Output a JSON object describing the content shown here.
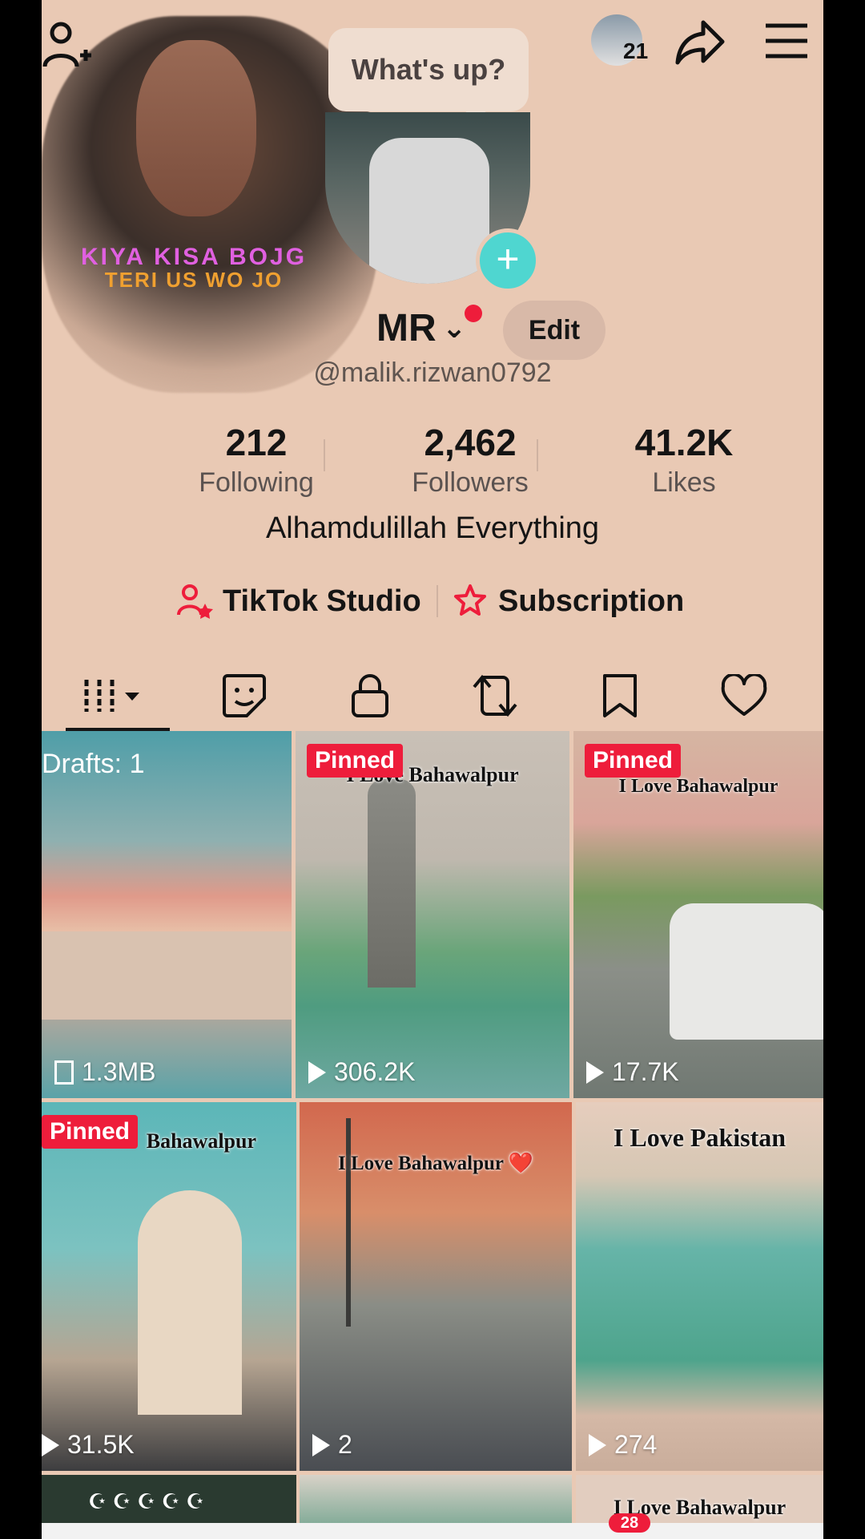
{
  "header": {
    "add_friend_icon": "person-add-icon",
    "notification_count": "21",
    "share_icon": "share-arrow-icon",
    "menu_icon": "hamburger-icon"
  },
  "tooltip": {
    "text": "What's up?"
  },
  "avatar_overlay": {
    "line1": "KIYA KISA BOJG",
    "line2": "TERI US WO JO"
  },
  "profile": {
    "name": "MR",
    "edit_label": "Edit",
    "handle": "@malik.rizwan0792",
    "bio": "Alhamdulillah Everything"
  },
  "stats": [
    {
      "value": "212",
      "label": "Following"
    },
    {
      "value": "2,462",
      "label": "Followers"
    },
    {
      "value": "41.2K",
      "label": "Likes"
    }
  ],
  "links": {
    "studio": "TikTok Studio",
    "subscription": "Subscription"
  },
  "tabs": [
    {
      "icon": "grid-icon"
    },
    {
      "icon": "sticker-icon"
    },
    {
      "icon": "lock-icon"
    },
    {
      "icon": "repost-icon"
    },
    {
      "icon": "bookmark-icon"
    },
    {
      "icon": "heart-icon"
    }
  ],
  "videos": [
    {
      "badge": "Drafts: 1",
      "caption": "",
      "count": "1.3MB"
    },
    {
      "badge": "Pinned",
      "caption": "I Love Bahawalpur",
      "count": "306.2K"
    },
    {
      "badge": "Pinned",
      "caption": "I Love Bahawalpur",
      "count": "17.7K"
    },
    {
      "badge": "Pinned",
      "caption": "Bahawalpur",
      "count": "31.5K"
    },
    {
      "badge": "",
      "caption": "I Love Bahawalpur ❤️",
      "count": "2"
    },
    {
      "badge": "",
      "caption": "I Love Pakistan",
      "count": "274"
    },
    {
      "badge": "",
      "caption": "",
      "count": ""
    },
    {
      "badge": "",
      "caption": "",
      "count": ""
    },
    {
      "badge": "",
      "caption": "I Love Bahawalpur",
      "count": ""
    }
  ],
  "bottom_badge": "28",
  "colors": {
    "accent": "#ee1d3b",
    "teal": "#4fd6d0",
    "background": "#e9c9b4"
  }
}
